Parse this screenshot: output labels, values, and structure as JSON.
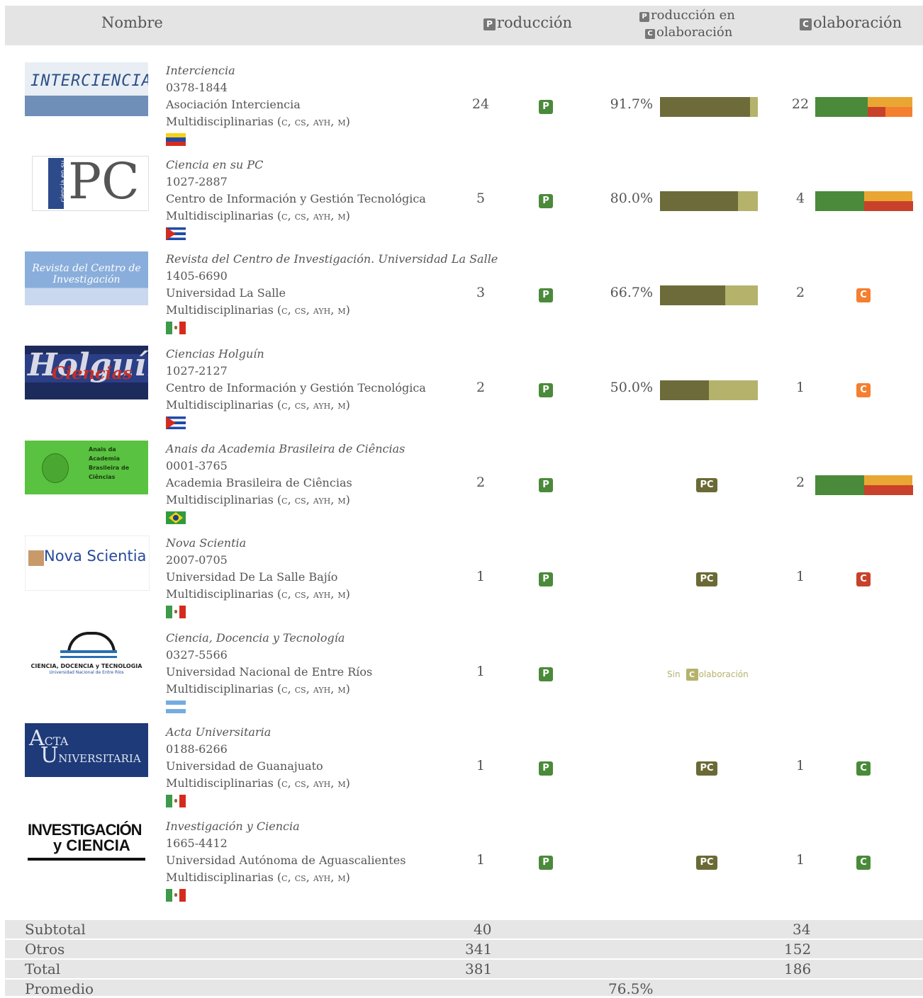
{
  "header": {
    "name": "Nombre",
    "production_icon": "P",
    "production_rest": "roducción",
    "collab_prod_line1_icon": "P",
    "collab_prod_line1_rest": "roducción en",
    "collab_prod_line2_icon": "C",
    "collab_prod_line2_rest": "olaboración",
    "collab_icon": "C",
    "collab_rest": "olaboración"
  },
  "badges": {
    "p": "P",
    "pc": "PC",
    "c": "C"
  },
  "colors": {
    "p_badge": "#4a8a3a",
    "pc_badge": "#6b6a36",
    "bar_dark": "#6d6b39",
    "bar_light": "#b5b26c",
    "collab_green": "#4a8a3a",
    "collab_yellow": "#eaa633",
    "collab_red": "#c9412a",
    "collab_orange": "#f47f30"
  },
  "journals": [
    {
      "title": "Interciencia",
      "issn": "0378-1844",
      "publisher": "Asociación Interciencia",
      "area": "Multidisciplinarias (",
      "area_sc": "c, cs, ayh, m",
      "area_end": ")",
      "country_flag": "venezuela-flag",
      "production": "24",
      "pct": "91.7%",
      "pct_value": 91.7,
      "collab": "22",
      "collab_bar": {
        "green": 0.54,
        "yellow": 0.46,
        "red": 0.18,
        "orange": 0.28
      }
    },
    {
      "title": "Ciencia en su PC",
      "issn": "1027-2887",
      "publisher": "Centro de Información y Gestión Tecnológica",
      "area": "Multidisciplinarias (",
      "area_sc": "c, cs, ayh, m",
      "area_end": ")",
      "country_flag": "cuba-flag",
      "production": "5",
      "pct": "80.0%",
      "pct_value": 80.0,
      "collab": "4",
      "collab_bar": {
        "green": 0.5,
        "yellow": 0.5,
        "red": 0.5,
        "orange": 0
      }
    },
    {
      "title": "Revista del Centro de Investigación. Universidad La Salle",
      "issn": "1405-6690",
      "publisher": "Universidad La Salle",
      "area": "Multidisciplinarias (",
      "area_sc": "c, cs, ayh, m",
      "area_end": ")",
      "country_flag": "mexico-flag",
      "production": "3",
      "pct": "66.7%",
      "pct_value": 66.7,
      "collab": "2",
      "collab_badge_color": "#f47f30"
    },
    {
      "title": "Ciencias Holguín",
      "issn": "1027-2127",
      "publisher": "Centro de Información y Gestión Tecnológica",
      "area": "Multidisciplinarias (",
      "area_sc": "c, cs, ayh, m",
      "area_end": ")",
      "country_flag": "cuba-flag",
      "production": "2",
      "pct": "50.0%",
      "pct_value": 50.0,
      "collab": "1",
      "collab_badge_color": "#f47f30"
    },
    {
      "title": "Anais da Academia Brasileira de Ciências",
      "issn": "0001-3765",
      "publisher": "Academia Brasileira de Ciências",
      "area": "Multidisciplinarias (",
      "area_sc": "c, cs, ayh, m",
      "area_end": ")",
      "country_flag": "brazil-flag",
      "production": "2",
      "collab": "2",
      "collab_bar": {
        "green": 0.5,
        "yellow": 0.5,
        "red": 0.5,
        "orange": 0
      }
    },
    {
      "title": "Nova Scientia",
      "issn": "2007-0705",
      "publisher": "Universidad De La Salle Bajío",
      "area": "Multidisciplinarias (",
      "area_sc": "c, cs, ayh, m",
      "area_end": ")",
      "country_flag": "mexico-flag",
      "production": "1",
      "collab": "1",
      "collab_badge_color": "#c9412a"
    },
    {
      "title": "Ciencia, Docencia y Tecnología",
      "issn": "0327-5566",
      "publisher": "Universidad Nacional de Entre Ríos",
      "area": "Multidisciplinarias (",
      "area_sc": "c, cs, ayh, m",
      "area_end": ")",
      "country_flag": "argentina-flag",
      "production": "1",
      "no_collab_sin": "Sin",
      "no_collab_icon": "C",
      "no_collab_rest": "olaboración"
    },
    {
      "title": "Acta Universitaria",
      "issn": "0188-6266",
      "publisher": "Universidad de Guanajuato",
      "area": "Multidisciplinarias (",
      "area_sc": "c, cs, ayh, m",
      "area_end": ")",
      "country_flag": "mexico-flag",
      "production": "1",
      "collab": "1",
      "collab_badge_color": "#4a8a3a"
    },
    {
      "title": "Investigación y Ciencia",
      "issn": "1665-4412",
      "publisher": "Universidad Autónoma de Aguascalientes",
      "area": "Multidisciplinarias (",
      "area_sc": "c, cs, ayh, m",
      "area_end": ")",
      "country_flag": "mexico-flag",
      "production": "1",
      "collab": "1",
      "collab_badge_color": "#4a8a3a"
    }
  ],
  "logos": {
    "interciencia": "INTERCIENCIA",
    "pc_side": "ciencia en su",
    "pc_main": "PC",
    "revista_line1": "Revista del Centro de",
    "revista_line2": "Investigación",
    "holguin_back": "Holguín",
    "holguin_front": "Ciencias",
    "anais_text": "Anais da Academia Brasileira de Ciências",
    "nova": "Nova Scientia",
    "cdt_main": "CIENCIA, DOCENCIA y TECNOLOGIA",
    "cdt_sub": "Universidad Nacional de Entre Ríos",
    "acta_a": "A",
    "acta_rest": "CTA",
    "acta_u": "U",
    "acta_rest2": "NIVERSITARIA",
    "inv_line1": "INVESTIGACIÓN",
    "inv_line2": "y CIENCIA"
  },
  "footer": {
    "subtotal_label": "Subtotal",
    "subtotal_prod": "40",
    "subtotal_collab": "34",
    "otros_label": "Otros",
    "otros_prod": "341",
    "otros_collab": "152",
    "total_label": "Total",
    "total_prod": "381",
    "total_collab": "186",
    "promedio_label": "Promedio",
    "promedio_value": "76.5%"
  }
}
